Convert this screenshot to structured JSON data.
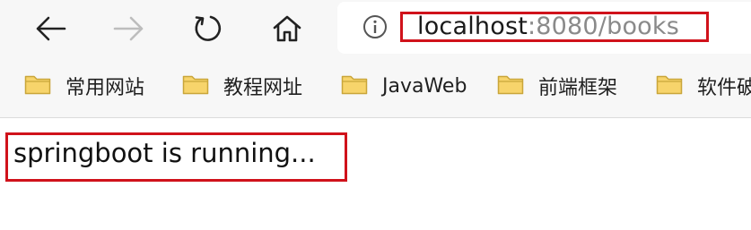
{
  "toolbar": {
    "back_icon": "arrow-left-icon",
    "forward_icon": "arrow-right-icon",
    "refresh_icon": "refresh-icon",
    "home_icon": "home-icon"
  },
  "address_bar": {
    "info_icon": "info-icon",
    "host": "localhost",
    "path": ":8080/books"
  },
  "bookmarks": [
    {
      "label": "常用网站",
      "icon": "folder-icon"
    },
    {
      "label": "教程网址",
      "icon": "folder-icon"
    },
    {
      "label": "JavaWeb",
      "icon": "folder-icon"
    },
    {
      "label": "前端框架",
      "icon": "folder-icon"
    },
    {
      "label": "软件破",
      "icon": "folder-icon"
    }
  ],
  "page": {
    "content_text": "springboot is running..."
  },
  "colors": {
    "annotation_red": "#d0121b",
    "folder_fill": "#f7d46b",
    "folder_stroke": "#c9a63a",
    "chrome_bg": "#f7f7f7"
  }
}
